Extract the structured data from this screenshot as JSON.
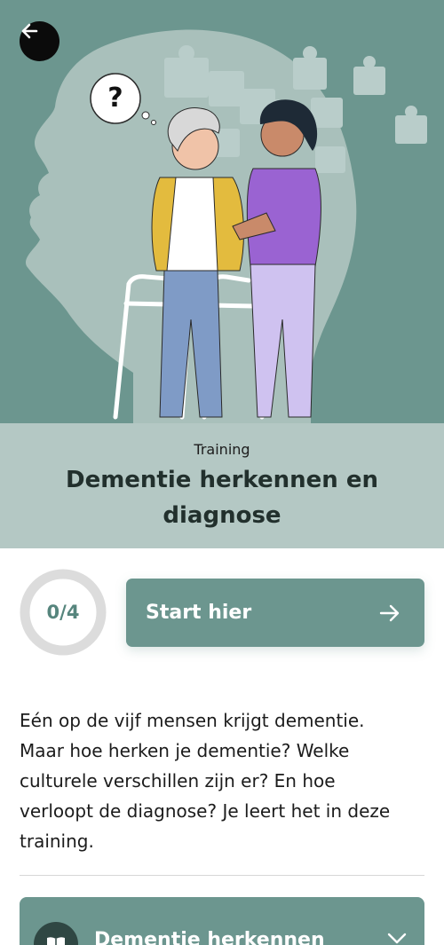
{
  "hero": {
    "illustration_icon": "dementia-care-illustration",
    "question_mark": "?",
    "colors": {
      "background": "#6c968f",
      "silhouette": "#a9c0bb",
      "puzzle": "#b9cdca"
    }
  },
  "nav": {
    "back_icon": "arrow-left-icon"
  },
  "header": {
    "eyebrow": "Training",
    "title": "Dementie herkennen en diagnose"
  },
  "progress": {
    "label": "0/4",
    "completed": 0,
    "total": 4
  },
  "start_button": {
    "label": "Start hier",
    "icon": "arrow-right-icon"
  },
  "description": "Eén op de vijf mensen krijgt dementie. Maar hoe herken je dementie? Welke culturele verschillen zijn er? En hoe verloopt de diagnose? Je leert het in deze training.",
  "module": {
    "title": "Dementie herkennen",
    "icon": "book-icon",
    "chevron": "chevron-down-icon"
  },
  "colors": {
    "accent": "#6c968f",
    "band": "#b4c8c4",
    "title": "#22302d",
    "ring": "#dcdcdc"
  }
}
